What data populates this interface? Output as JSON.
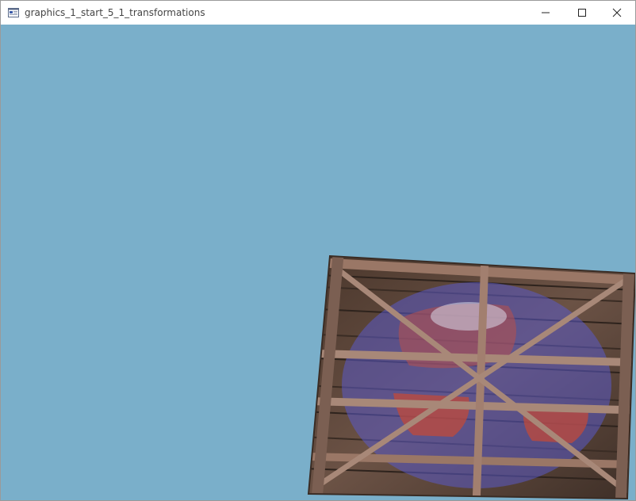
{
  "window": {
    "title": "graphics_1_start_5_1_transformations"
  },
  "icons": {
    "app": "app-window-icon",
    "minimize": "minimize-icon",
    "maximize": "maximize-icon",
    "close": "close-icon"
  },
  "scene": {
    "clear_color": "#7aafca",
    "texture_wood": "container-wood-texture",
    "texture_overlay": "awesomeface-texture",
    "overlay_color": "#5a5ac6",
    "wood_color": "#5a4336"
  }
}
